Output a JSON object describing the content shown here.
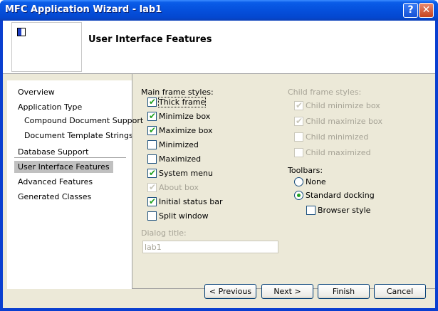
{
  "window": {
    "title": "MFC Application Wizard - lab1",
    "help_glyph": "?",
    "close_glyph": "✕"
  },
  "header": {
    "title": "User Interface Features"
  },
  "nav": {
    "items": [
      {
        "label": "Overview"
      },
      {
        "label": "Application Type"
      },
      {
        "label": "Compound Document Support"
      },
      {
        "label": "Document Template Strings"
      },
      {
        "label": "Database Support"
      },
      {
        "label": "User Interface Features"
      },
      {
        "label": "Advanced Features"
      },
      {
        "label": "Generated Classes"
      }
    ],
    "selected": "User Interface Features"
  },
  "main_frame": {
    "label": "Main frame styles:",
    "options": [
      {
        "label": "Thick frame",
        "checked": true,
        "enabled": true
      },
      {
        "label": "Minimize box",
        "checked": true,
        "enabled": true
      },
      {
        "label": "Maximize box",
        "checked": true,
        "enabled": true
      },
      {
        "label": "Minimized",
        "checked": false,
        "enabled": true
      },
      {
        "label": "Maximized",
        "checked": false,
        "enabled": true
      },
      {
        "label": "System menu",
        "checked": true,
        "enabled": true
      },
      {
        "label": "About box",
        "checked": true,
        "enabled": false
      },
      {
        "label": "Initial status bar",
        "checked": true,
        "enabled": true
      },
      {
        "label": "Split window",
        "checked": false,
        "enabled": true
      }
    ]
  },
  "child_frame": {
    "label": "Child frame styles:",
    "options": [
      {
        "label": "Child minimize box",
        "checked": true,
        "enabled": false
      },
      {
        "label": "Child maximize box",
        "checked": true,
        "enabled": false
      },
      {
        "label": "Child minimized",
        "checked": false,
        "enabled": false
      },
      {
        "label": "Child maximized",
        "checked": false,
        "enabled": false
      }
    ]
  },
  "toolbars": {
    "label": "Toolbars:",
    "options": [
      {
        "label": "None",
        "selected": false
      },
      {
        "label": "Standard docking",
        "selected": true
      }
    ],
    "browser_style": {
      "label": "Browser style",
      "checked": false
    }
  },
  "dialog_title": {
    "label": "Dialog title:",
    "value": "lab1"
  },
  "buttons": {
    "previous": "< Previous",
    "next": "Next >",
    "finish": "Finish",
    "cancel": "Cancel"
  },
  "colors": {
    "titlebar": "#0550dc",
    "dialog_bg": "#ece9d8",
    "check_mark": "#21a121"
  }
}
